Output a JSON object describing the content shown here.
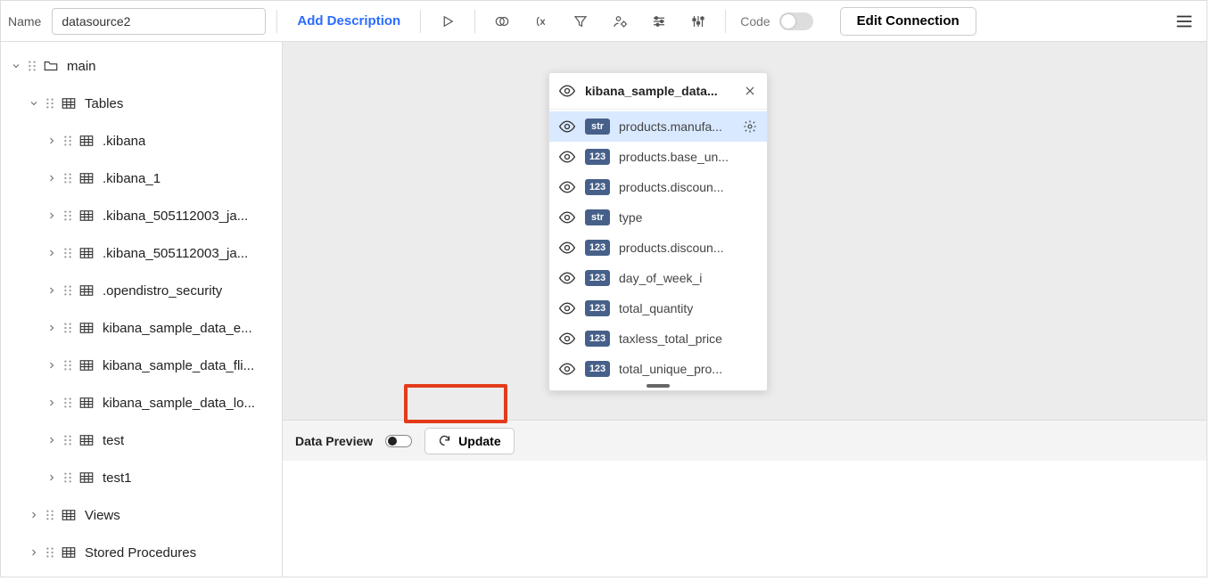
{
  "toolbar": {
    "name_label": "Name",
    "name_value": "datasource2",
    "add_description": "Add Description",
    "code_label": "Code",
    "edit_connection": "Edit Connection"
  },
  "tree": {
    "root": {
      "label": "main",
      "expanded": true
    },
    "tables_group": {
      "label": "Tables",
      "expanded": true
    },
    "views_group": {
      "label": "Views",
      "expanded": false
    },
    "sprocs_group": {
      "label": "Stored Procedures",
      "expanded": false
    },
    "tables": [
      {
        "label": ".kibana"
      },
      {
        "label": ".kibana_1"
      },
      {
        "label": ".kibana_505112003_ja..."
      },
      {
        "label": ".kibana_505112003_ja..."
      },
      {
        "label": ".opendistro_security"
      },
      {
        "label": "kibana_sample_data_e..."
      },
      {
        "label": "kibana_sample_data_fli..."
      },
      {
        "label": "kibana_sample_data_lo..."
      },
      {
        "label": "test"
      },
      {
        "label": "test1"
      }
    ]
  },
  "card": {
    "title": "kibana_sample_data...",
    "fields": [
      {
        "type": "str",
        "label": "products.manufa...",
        "selected": true
      },
      {
        "type": "123",
        "label": "products.base_un..."
      },
      {
        "type": "123",
        "label": "products.discoun..."
      },
      {
        "type": "str",
        "label": "type"
      },
      {
        "type": "123",
        "label": "products.discoun..."
      },
      {
        "type": "123",
        "label": "day_of_week_i"
      },
      {
        "type": "123",
        "label": "total_quantity"
      },
      {
        "type": "123",
        "label": "taxless_total_price"
      },
      {
        "type": "123",
        "label": "total_unique_pro..."
      }
    ]
  },
  "preview": {
    "label": "Data Preview",
    "update": "Update"
  }
}
